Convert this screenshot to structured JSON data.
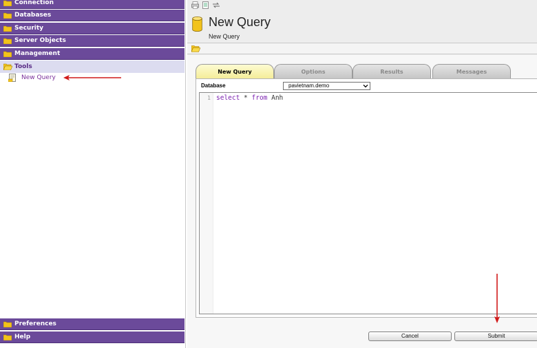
{
  "sidebar": {
    "top_items": [
      {
        "label": "Connection"
      },
      {
        "label": "Databases"
      },
      {
        "label": "Security"
      },
      {
        "label": "Server Objects"
      },
      {
        "label": "Management"
      }
    ],
    "tools": {
      "label": "Tools",
      "items": [
        {
          "label": "New Query",
          "icon": "query-doc-icon"
        }
      ]
    },
    "bottom_items": [
      {
        "label": "Preferences"
      },
      {
        "label": "Help"
      }
    ]
  },
  "toolbar": {
    "icons": [
      "print-icon",
      "document-icon",
      "refresh-icon"
    ]
  },
  "header": {
    "title": "New Query",
    "subtitle": "New Query",
    "icon": "database-cylinder-icon"
  },
  "tabs": [
    {
      "label": "New Query",
      "active": true
    },
    {
      "label": "Options",
      "active": false
    },
    {
      "label": "Results",
      "active": false
    },
    {
      "label": "Messages",
      "active": false
    }
  ],
  "form": {
    "database_label": "Database",
    "database_value": "pavietnam.demo"
  },
  "editor": {
    "line_number": "1",
    "code": {
      "kw1": "select",
      "star": " * ",
      "kw2": "from",
      "table": " Anh"
    }
  },
  "buttons": {
    "cancel": "Cancel",
    "submit": "Submit"
  },
  "colors": {
    "sidebar_header": "#6b4a9a",
    "active_tab": "#f4ec96",
    "annotation_arrow": "#d11a1a",
    "keyword": "#7a1fb0"
  }
}
